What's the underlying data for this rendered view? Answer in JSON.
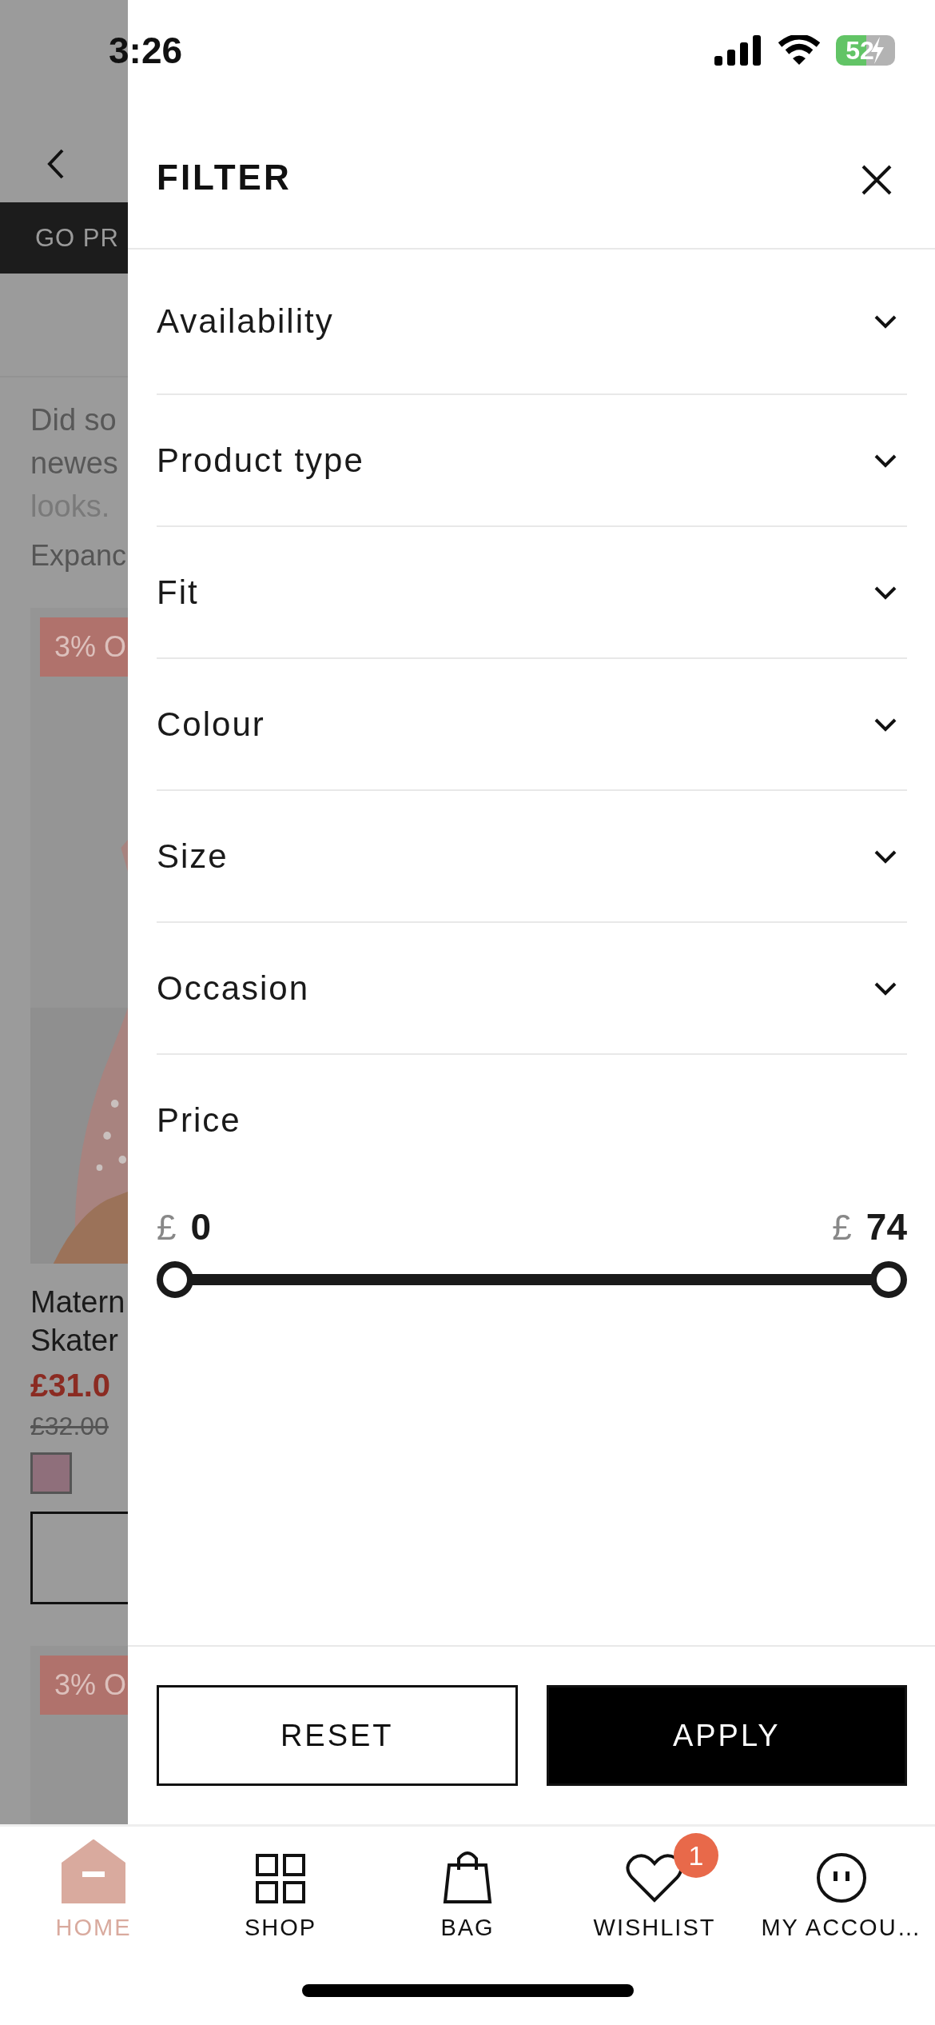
{
  "status_bar": {
    "time": "3:26",
    "battery": "52"
  },
  "background_page": {
    "banner": "GO PR",
    "intro_lines": [
      "Did so",
      "newes",
      "looks."
    ],
    "expand_link": "Expanc",
    "products": [
      {
        "badge": "3% O",
        "title_lines": [
          "Matern",
          "Skater"
        ],
        "price": "£31.0",
        "was_price": "£32.00"
      },
      {
        "badge": "3% O"
      }
    ]
  },
  "filter_panel": {
    "title": "FILTER",
    "sections": [
      {
        "label": "Availability",
        "expanded": false
      },
      {
        "label": "Product type",
        "expanded": false
      },
      {
        "label": "Fit",
        "expanded": false
      },
      {
        "label": "Colour",
        "expanded": false
      },
      {
        "label": "Size",
        "expanded": false
      },
      {
        "label": "Occasion",
        "expanded": false
      }
    ],
    "price": {
      "label": "Price",
      "currency_min": "£",
      "min": "0",
      "currency_max": "£",
      "max": "74",
      "thumbs": [
        {
          "level": 0
        },
        {
          "level": 1
        }
      ]
    },
    "buttons": [
      {
        "label": "RESET",
        "kind": "secondary"
      },
      {
        "label": "APPLY",
        "kind": "primary"
      }
    ]
  },
  "tab_bar": [
    {
      "label": "HOME",
      "selected": true
    },
    {
      "label": "SHOP",
      "selected": false
    },
    {
      "label": "BAG",
      "selected": false
    },
    {
      "label": "WISHLIST",
      "selected": false,
      "badge": "1"
    },
    {
      "label": "MY ACCOU…",
      "selected": false
    }
  ]
}
